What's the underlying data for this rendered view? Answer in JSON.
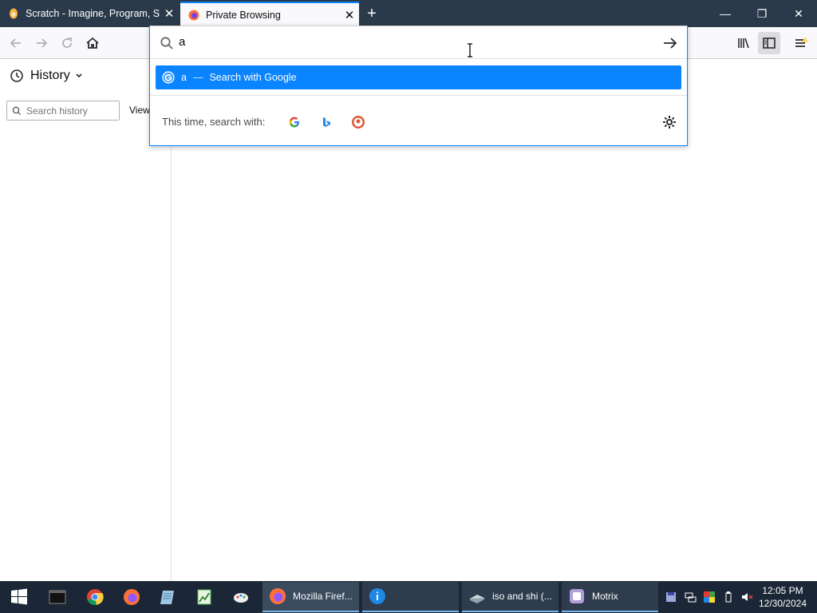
{
  "tabs": [
    {
      "title": "Scratch - Imagine, Program, Sh",
      "close": "✕",
      "icon": "scratch-icon"
    },
    {
      "title": "Private Browsing",
      "close": "✕",
      "icon": "firefox-icon"
    }
  ],
  "new_tab": "+",
  "window_controls": {
    "minimize": "—",
    "restore": "❐",
    "close": "✕"
  },
  "urlbar": {
    "value": "a"
  },
  "suggestion": {
    "query": "a",
    "separator": "—",
    "action": "Search with Google"
  },
  "one_off": {
    "label": "This time, search with:",
    "engines": [
      "google-icon",
      "bing-icon",
      "duckduckgo-icon"
    ]
  },
  "sidebar": {
    "title": "History",
    "search_placeholder": "Search history",
    "view_label": "View"
  },
  "taskbar": {
    "apps": [
      {
        "label": "Mozilla Firef..."
      },
      {
        "label": ""
      },
      {
        "label": "iso and shi (..."
      },
      {
        "label": "Motrix"
      }
    ],
    "clock": {
      "time": "12:05 PM",
      "date": "12/30/2024"
    }
  },
  "colors": {
    "accent": "#0a84ff",
    "tabstrip": "#2b3a4a",
    "taskbar": "#1b2736"
  }
}
